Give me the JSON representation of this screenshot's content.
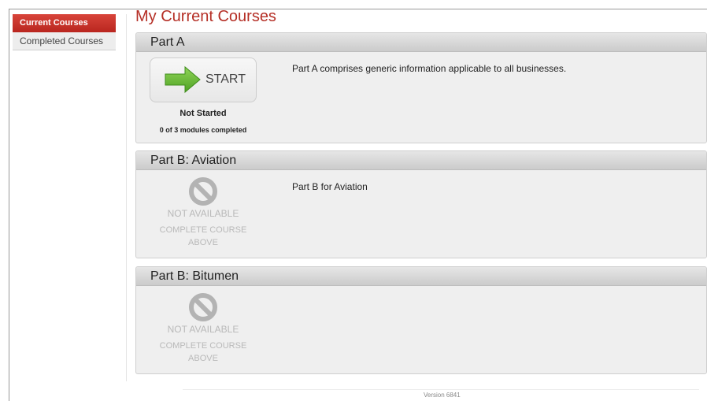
{
  "sidebar": {
    "items": [
      {
        "label": "Current Courses",
        "active": true
      },
      {
        "label": "Completed Courses",
        "active": false
      }
    ]
  },
  "page": {
    "title": "My Current Courses"
  },
  "courses": [
    {
      "title": "Part A",
      "description": "Part A comprises generic information applicable to all businesses.",
      "start_label": "START",
      "status": "Not Started",
      "progress": "0 of 3 modules completed",
      "icon": "arrow-right-icon"
    },
    {
      "title": "Part B: Aviation",
      "description": "Part B for Aviation",
      "status_title": "NOT AVAILABLE",
      "status_sub_1": "COMPLETE COURSE",
      "status_sub_2": "ABOVE",
      "icon": "prohibited-icon"
    },
    {
      "title": "Part B: Bitumen",
      "description": "",
      "status_title": "NOT AVAILABLE",
      "status_sub_1": "COMPLETE COURSE",
      "status_sub_2": "ABOVE",
      "icon": "prohibited-icon"
    }
  ],
  "footer": {
    "version": "Version 6841"
  },
  "colors": {
    "accent": "#b52f26",
    "start_arrow": "#6cbd3a",
    "disabled": "#b9b9b9"
  }
}
